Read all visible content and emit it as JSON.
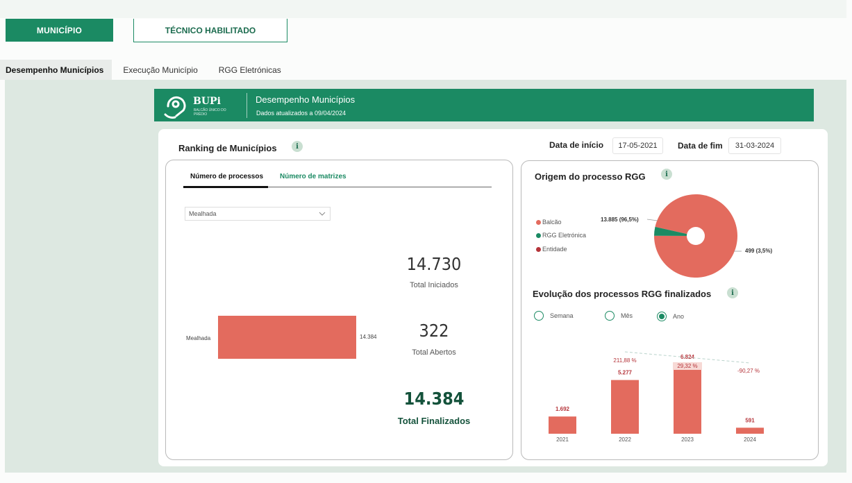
{
  "nav": {
    "municipio": "MUNICÍPIO",
    "tecnico": "TÉCNICO HABILITADO"
  },
  "tabs": [
    "Desempenho Municípios",
    "Execução Município",
    "RGG Eletrónicas"
  ],
  "header": {
    "brand": "BUPi",
    "brand_sub": "BALCÃO ÚNICO DO PRÉDIO",
    "title": "Desempenho Municípios",
    "subtitle": "Dados atualizados a 09/04/2024"
  },
  "ranking": {
    "title": "Ranking de Municípios",
    "info": "i",
    "subtabs": [
      "Número de processos",
      "Número de matrizes"
    ],
    "dropdown": "Mealhada",
    "bar_label": "Mealhada",
    "bar_value": "14.384",
    "bar_value_num": 14384
  },
  "dates": {
    "start_label": "Data de início",
    "start": "17-05-2021",
    "end_label": "Data de fim",
    "end": "31-03-2024"
  },
  "kpis": [
    {
      "value": "14.730",
      "label": "Total Iniciados"
    },
    {
      "value": "322",
      "label": "Total Abertos"
    },
    {
      "value": "14.384",
      "label": "Total Finalizados"
    }
  ],
  "origem": {
    "title": "Origem do processo RGG",
    "legend": [
      {
        "label": "Balcão",
        "color": "#e36b5e"
      },
      {
        "label": "RGG Eletrónica",
        "color": "#1b8a63"
      },
      {
        "label": "Entidade",
        "color": "#b5343a"
      }
    ],
    "label_balcao": "13.885 (96,5%)",
    "label_rgg": "499 (3,5%)"
  },
  "evolucao": {
    "title": "Evolução dos processos RGG finalizados",
    "radios": [
      "Semana",
      "Mês",
      "Ano"
    ],
    "selected": "Ano"
  },
  "chart_data": [
    {
      "type": "pie",
      "labels": [
        "Balcão",
        "RGG Eletrónica",
        "Entidade"
      ],
      "values": [
        13885,
        499,
        0
      ],
      "percent": [
        96.5,
        3.5,
        0
      ],
      "colors": [
        "#e36b5e",
        "#1b8a63",
        "#b5343a"
      ]
    },
    {
      "type": "bar",
      "categories": [
        "2021",
        "2022",
        "2023",
        "2024"
      ],
      "values": [
        1692,
        5277,
        6824,
        591
      ],
      "value_labels": [
        "1.692",
        "5.277",
        "6.824",
        "591"
      ],
      "growth_labels": [
        "211,88 %",
        "29,32 %",
        "-90,27 %"
      ],
      "color": "#e36b5e"
    }
  ]
}
